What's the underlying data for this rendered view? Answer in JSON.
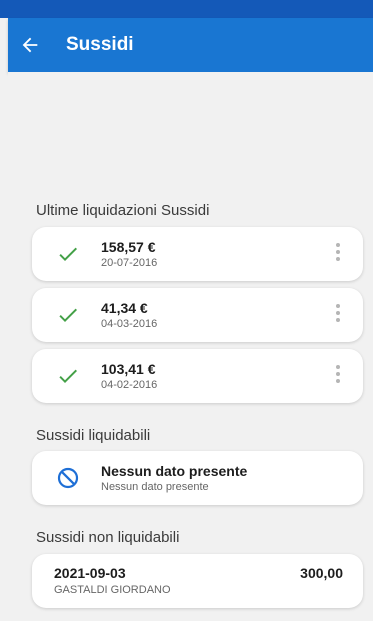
{
  "header": {
    "title": "Sussidi",
    "back_icon": "arrow-left-icon"
  },
  "colors": {
    "app_bar": "#1976d2",
    "check": "#43a047",
    "blocked": "#1e6fd6"
  },
  "sections": {
    "ultime": {
      "title": "Ultime liquidazioni Sussidi",
      "items": [
        {
          "amount": "158,57 €",
          "date": "20-07-2016"
        },
        {
          "amount": "41,34 €",
          "date": "04-03-2016"
        },
        {
          "amount": "103,41 €",
          "date": "04-02-2016"
        }
      ]
    },
    "liquidabili": {
      "title": "Sussidi liquidabili",
      "empty_title": "Nessun dato presente",
      "empty_subtitle": "Nessun dato presente"
    },
    "non_liquidabili": {
      "title": "Sussidi non liquidabili",
      "items": [
        {
          "date": "2021-09-03",
          "name": "GASTALDI GIORDANO",
          "value": "300,00"
        }
      ]
    }
  }
}
